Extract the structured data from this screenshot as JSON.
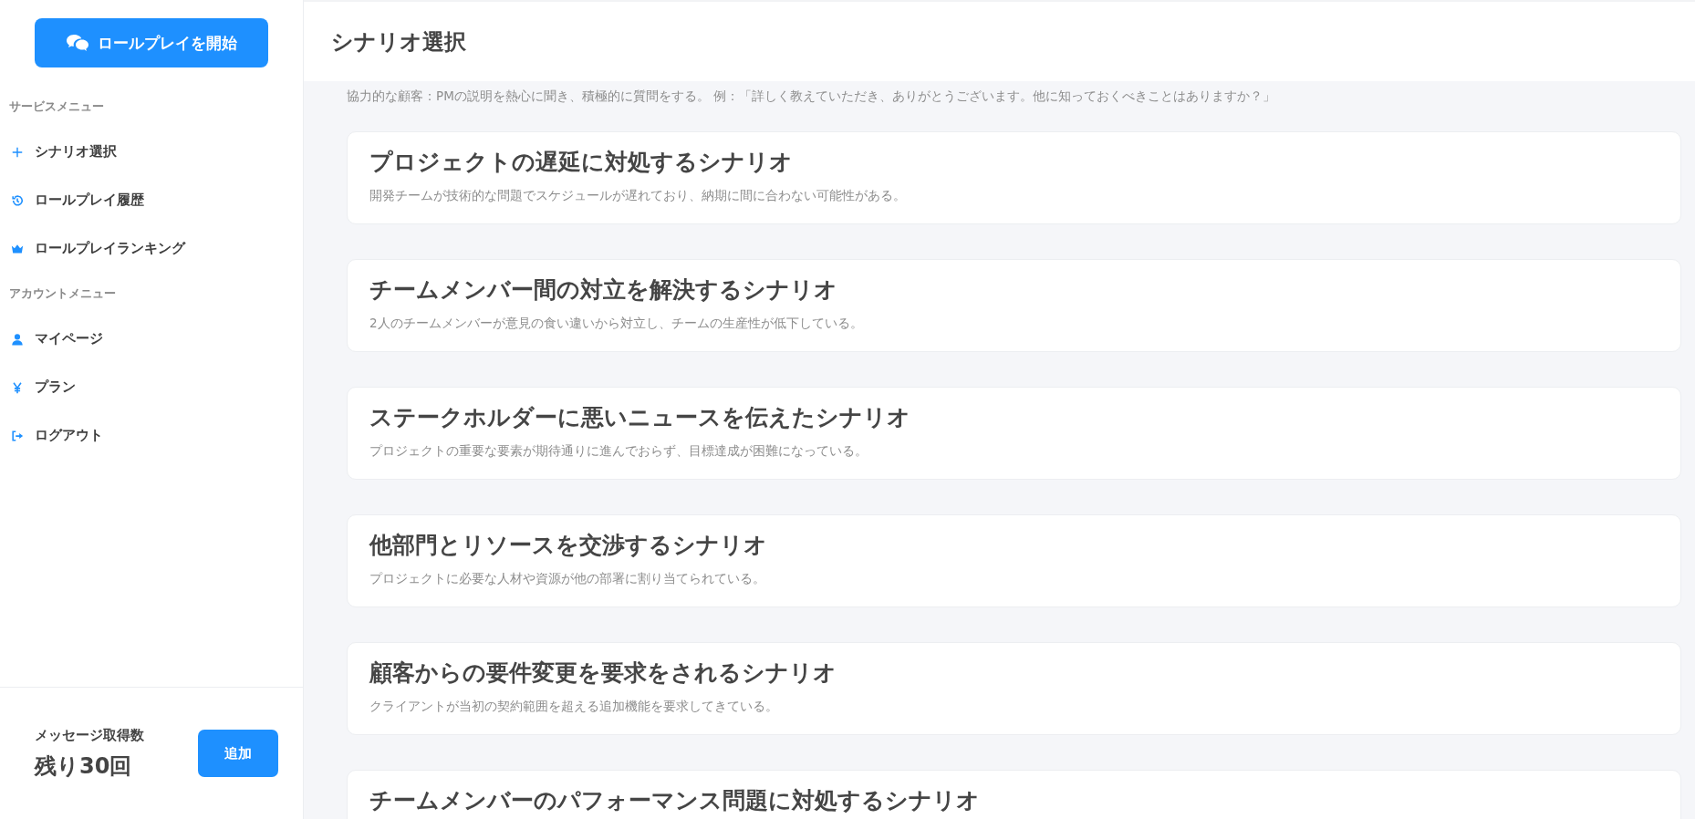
{
  "sidebar": {
    "start_button": "ロールプレイを開始",
    "sections": [
      {
        "heading": "サービスメニュー",
        "items": [
          "シナリオ選択",
          "ロールプレイ履歴",
          "ロールプレイランキング"
        ]
      },
      {
        "heading": "アカウントメニュー",
        "items": [
          "マイページ",
          "プラン",
          "ログアウト"
        ]
      }
    ],
    "quota": {
      "label": "メッセージ取得数",
      "remaining": "残り30回",
      "button": "追加"
    }
  },
  "header": {
    "title": "シナリオ選択"
  },
  "intro": "協力的な顧客：PMの説明を熱心に聞き、積極的に質問をする。 例：「詳しく教えていただき、ありがとうございます。他に知っておくべきことはありますか？」",
  "scenarios": [
    {
      "title": "プロジェクトの遅延に対処するシナリオ",
      "description": "開発チームが技術的な問題でスケジュールが遅れており、納期に間に合わない可能性がある。"
    },
    {
      "title": "チームメンバー間の対立を解決するシナリオ",
      "description": "2人のチームメンバーが意見の食い違いから対立し、チームの生産性が低下している。"
    },
    {
      "title": "ステークホルダーに悪いニュースを伝えたシナリオ",
      "description": "プロジェクトの重要な要素が期待通りに進んでおらず、目標達成が困難になっている。"
    },
    {
      "title": "他部門とリソースを交渉するシナリオ",
      "description": "プロジェクトに必要な人材や資源が他の部署に割り当てられている。"
    },
    {
      "title": "顧客からの要件変更を要求をされるシナリオ",
      "description": "クライアントが当初の契約範囲を超える追加機能を要求してきている。"
    },
    {
      "title": "チームメンバーのパフォーマンス問題に対処するシナリオ"
    }
  ]
}
